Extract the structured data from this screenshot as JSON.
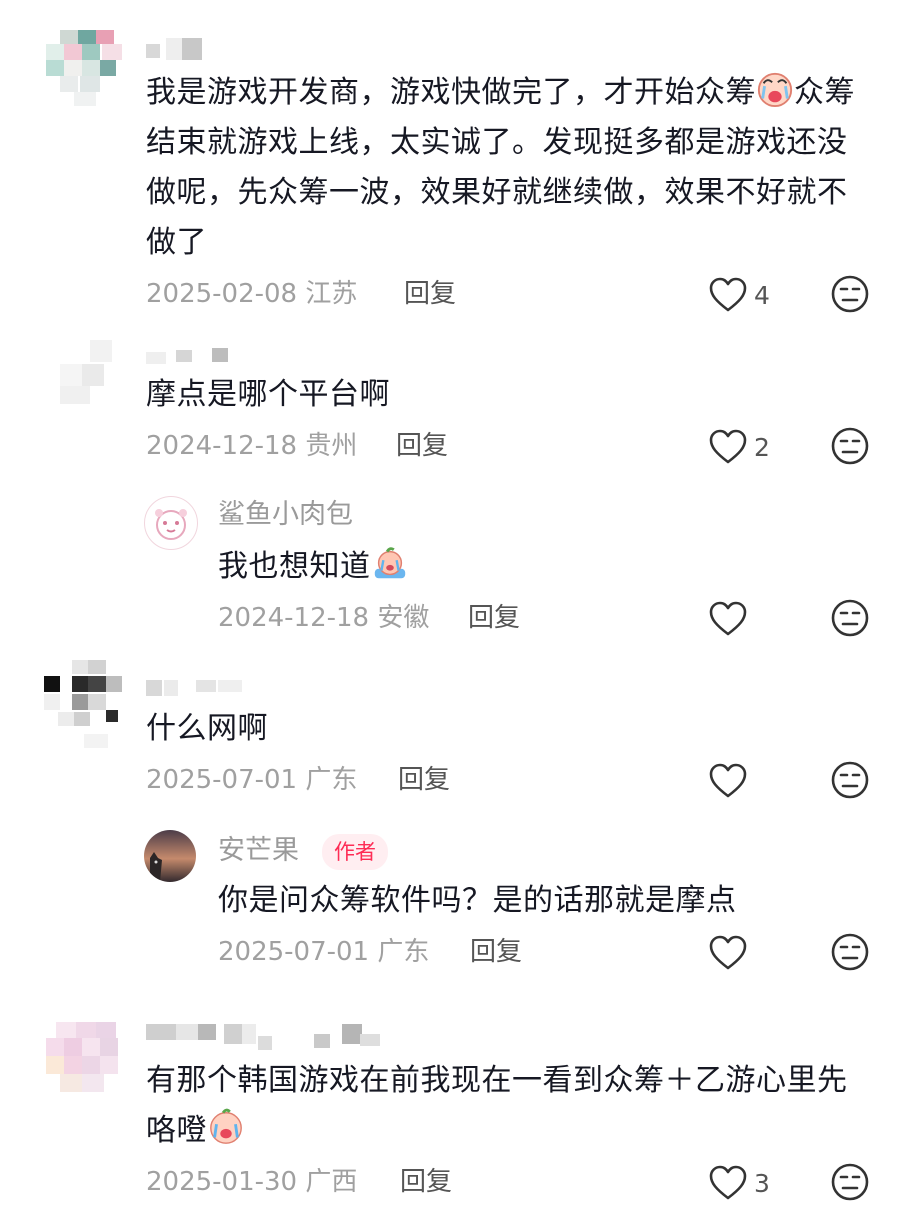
{
  "comments": [
    {
      "text": "我是游戏开发商，游戏快做完了，才开始众筹",
      "text2": "众筹结束就游戏上线，太实诚了。发现挺多都是游戏还没做呢，先众筹一波，效果好就继续做，效果不好就不做了",
      "date": "2025-02-08",
      "location": "江苏",
      "reply_label": "回复",
      "likes": "4"
    },
    {
      "text": "摩点是哪个平台啊",
      "date": "2024-12-18",
      "location": "贵州",
      "reply_label": "回复",
      "likes": "2",
      "reply": {
        "author": "鲨鱼小肉包",
        "text": "我也想知道",
        "date": "2024-12-18",
        "location": "安徽",
        "reply_label": "回复"
      }
    },
    {
      "text": "什么网啊",
      "date": "2025-07-01",
      "location": "广东",
      "reply_label": "回复",
      "reply": {
        "author": "安芒果",
        "badge": "作者",
        "text": "你是问众筹软件吗？是的话那就是摩点",
        "date": "2025-07-01",
        "location": "广东",
        "reply_label": "回复"
      }
    },
    {
      "text": "有那个韩国游戏在前我现在一看到众筹＋乙游心里先咯噔",
      "date": "2025-01-30",
      "location": "广西",
      "reply_label": "回复",
      "likes": "3"
    }
  ],
  "icons": {
    "like": "heart-outline-icon",
    "dislike": "neutral-face-icon",
    "emoji1": "crying-face-emoji",
    "emoji2": "crying-peach-emoji",
    "emoji3": "crying-face-emoji"
  }
}
